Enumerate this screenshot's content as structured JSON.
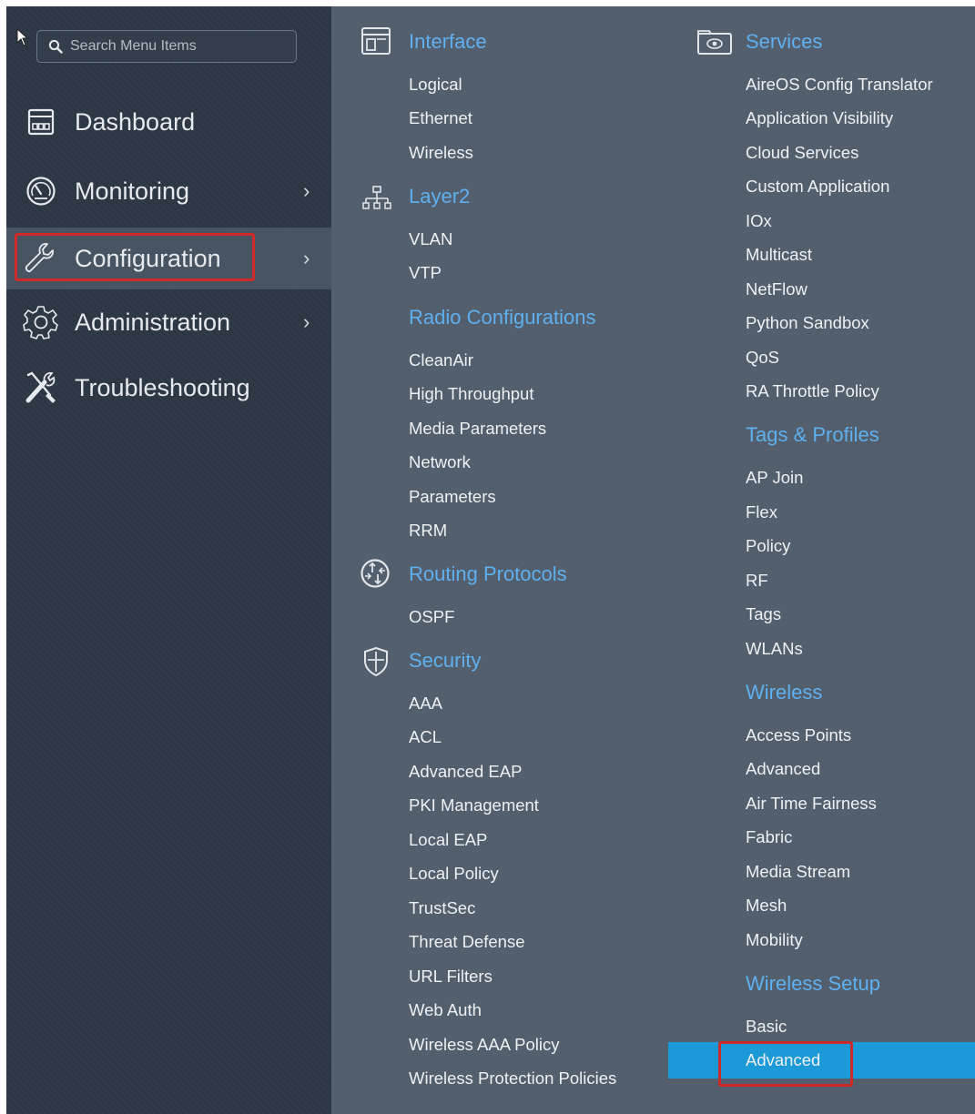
{
  "search": {
    "placeholder": "Search Menu Items"
  },
  "sidebar": {
    "items": [
      {
        "label": "Dashboard",
        "icon": "dashboard-icon",
        "has_submenu": false
      },
      {
        "label": "Monitoring",
        "icon": "gauge-icon",
        "has_submenu": true
      },
      {
        "label": "Configuration",
        "icon": "wrench-icon",
        "has_submenu": true,
        "active": true
      },
      {
        "label": "Administration",
        "icon": "gear-icon",
        "has_submenu": true
      },
      {
        "label": "Troubleshooting",
        "icon": "tools-icon",
        "has_submenu": false
      }
    ],
    "chevron": "›"
  },
  "menu": {
    "interface": {
      "title": "Interface",
      "icon": "interface-icon",
      "items": [
        "Logical",
        "Ethernet",
        "Wireless"
      ]
    },
    "layer2": {
      "title": "Layer2",
      "icon": "network-tree-icon",
      "items": [
        "VLAN",
        "VTP"
      ]
    },
    "radio": {
      "title": "Radio Configurations",
      "items": [
        "CleanAir",
        "High Throughput",
        "Media Parameters",
        "Network",
        "Parameters",
        "RRM"
      ]
    },
    "routing": {
      "title": "Routing Protocols",
      "icon": "router-icon",
      "items": [
        "OSPF"
      ]
    },
    "security": {
      "title": "Security",
      "icon": "shield-icon",
      "items": [
        "AAA",
        "ACL",
        "Advanced EAP",
        "PKI Management",
        "Local EAP",
        "Local Policy",
        "TrustSec",
        "Threat Defense",
        "URL Filters",
        "Web Auth",
        "Wireless AAA Policy",
        "Wireless Protection Policies"
      ]
    },
    "services": {
      "title": "Services",
      "icon": "services-icon",
      "items": [
        "AireOS Config Translator",
        "Application Visibility",
        "Cloud Services",
        "Custom Application",
        "IOx",
        "Multicast",
        "NetFlow",
        "Python Sandbox",
        "QoS",
        "RA Throttle Policy"
      ]
    },
    "tags": {
      "title": "Tags & Profiles",
      "items": [
        "AP Join",
        "Flex",
        "Policy",
        "RF",
        "Tags",
        "WLANs"
      ]
    },
    "wireless": {
      "title": "Wireless",
      "items": [
        "Access Points",
        "Advanced",
        "Air Time Fairness",
        "Fabric",
        "Media Stream",
        "Mesh",
        "Mobility"
      ]
    },
    "wireless_setup": {
      "title": "Wireless Setup",
      "items": [
        "Basic",
        "Advanced"
      ],
      "selected": "Advanced"
    }
  },
  "colors": {
    "sidebar_bg": "#2d3643",
    "menu_bg": "#535f6d",
    "section_title": "#5fb0f0",
    "selected_bg": "#1b9ad7",
    "highlight_border": "#d02a2a"
  }
}
